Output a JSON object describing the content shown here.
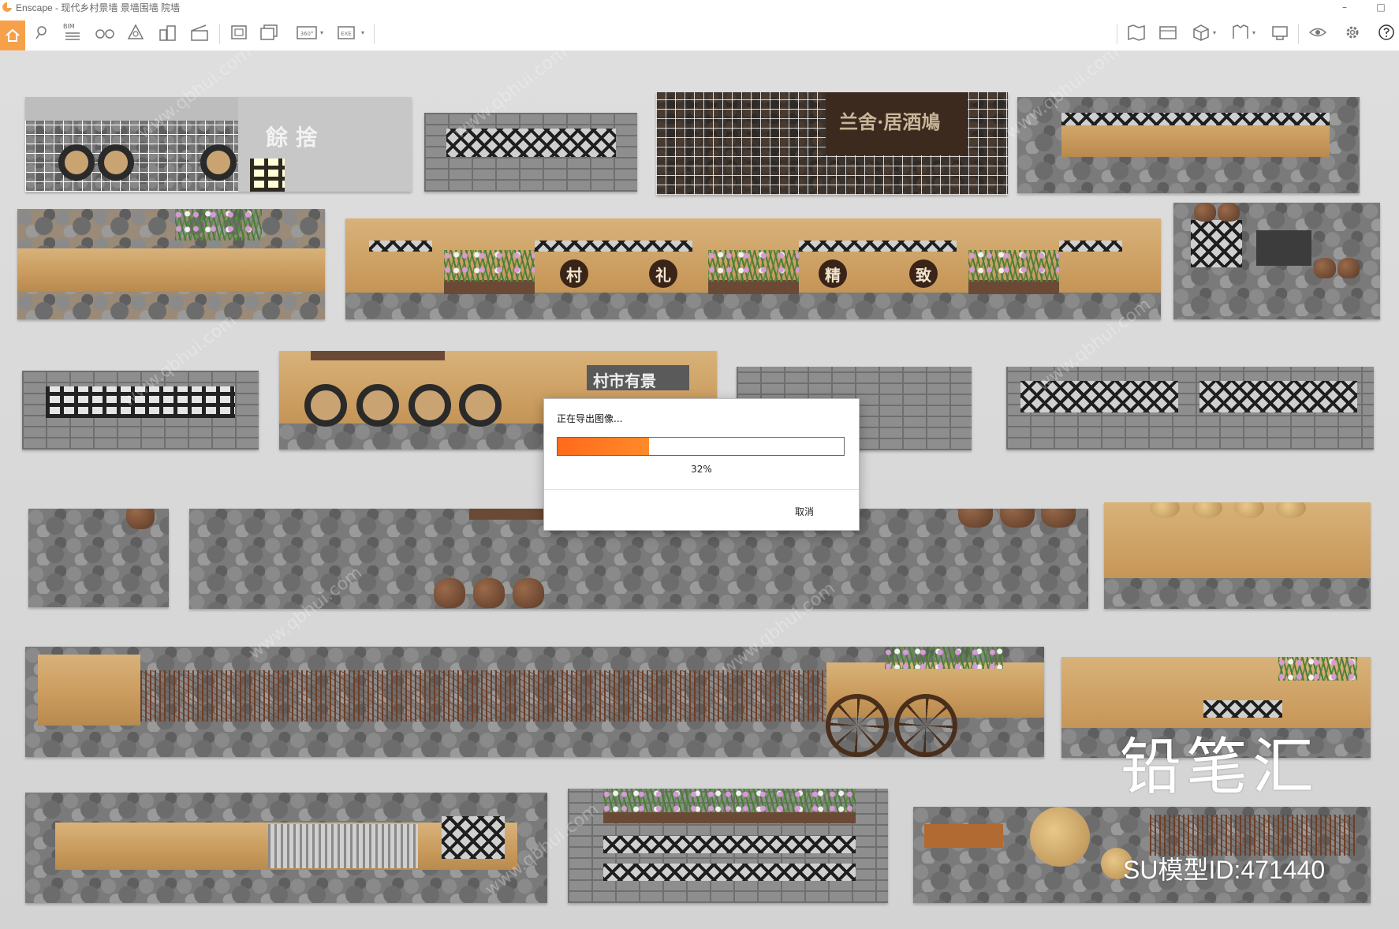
{
  "window": {
    "title": "Enscape - 现代乡村景墙 景墙围墙 院墙",
    "minimize": "–",
    "maximize": "□"
  },
  "toolbar": {
    "bim_label": "BIM",
    "view_360_label": "360°",
    "exe_label": "EXE",
    "dropdown_caret": "▾",
    "accent": "#f6a14a"
  },
  "scene": {
    "sign_1": "餘 捨",
    "sign_2": "兰舍·居酒鳩",
    "sign_3": "村市有景",
    "badges": [
      "村",
      "礼",
      "精",
      "致"
    ]
  },
  "watermarks": {
    "logo": "铅笔汇",
    "model_id": "SU模型ID:471440"
  },
  "dialog": {
    "title": "正在导出图像...",
    "progress_fraction": 0.32,
    "progress_label": "32%",
    "cancel_label": "取消",
    "progress_color": "#ff6a1a"
  }
}
